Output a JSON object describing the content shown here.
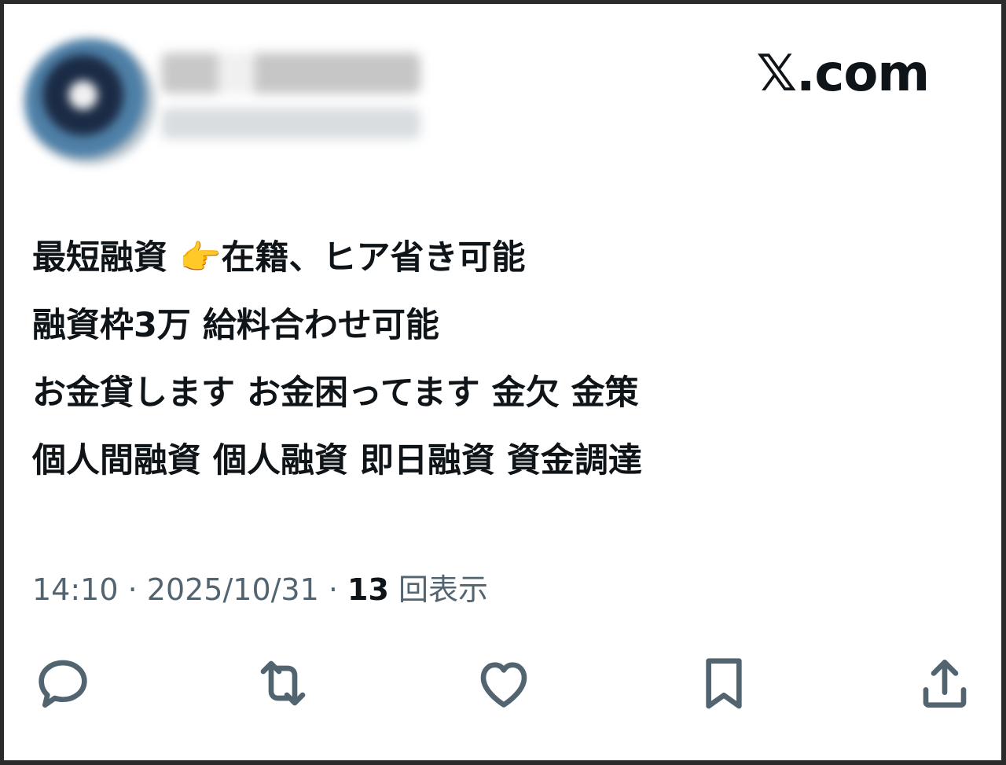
{
  "brand": {
    "label": "𝕏.com"
  },
  "post": {
    "lines": [
      "最短融資 👉在籍、ヒア省き可能",
      "融資枠3万  給料合わせ可能",
      "お金貸します お金困ってます 金欠 金策",
      "個人間融資 個人融資 即日融資 資金調達"
    ]
  },
  "meta": {
    "time": "14:10",
    "separator1": " · ",
    "date": "2025/10/31",
    "separator2": " · ",
    "views_count": "13",
    "views_label": " 回表示"
  },
  "actions": [
    {
      "name": "reply",
      "icon": "reply-icon"
    },
    {
      "name": "repost",
      "icon": "repost-icon"
    },
    {
      "name": "like",
      "icon": "heart-icon"
    },
    {
      "name": "bookmark",
      "icon": "bookmark-icon"
    },
    {
      "name": "share",
      "icon": "share-icon"
    }
  ],
  "colors": {
    "text": "#0f1419",
    "secondary": "#536471",
    "background": "#ffffff",
    "frame": "#2b2b2b"
  }
}
